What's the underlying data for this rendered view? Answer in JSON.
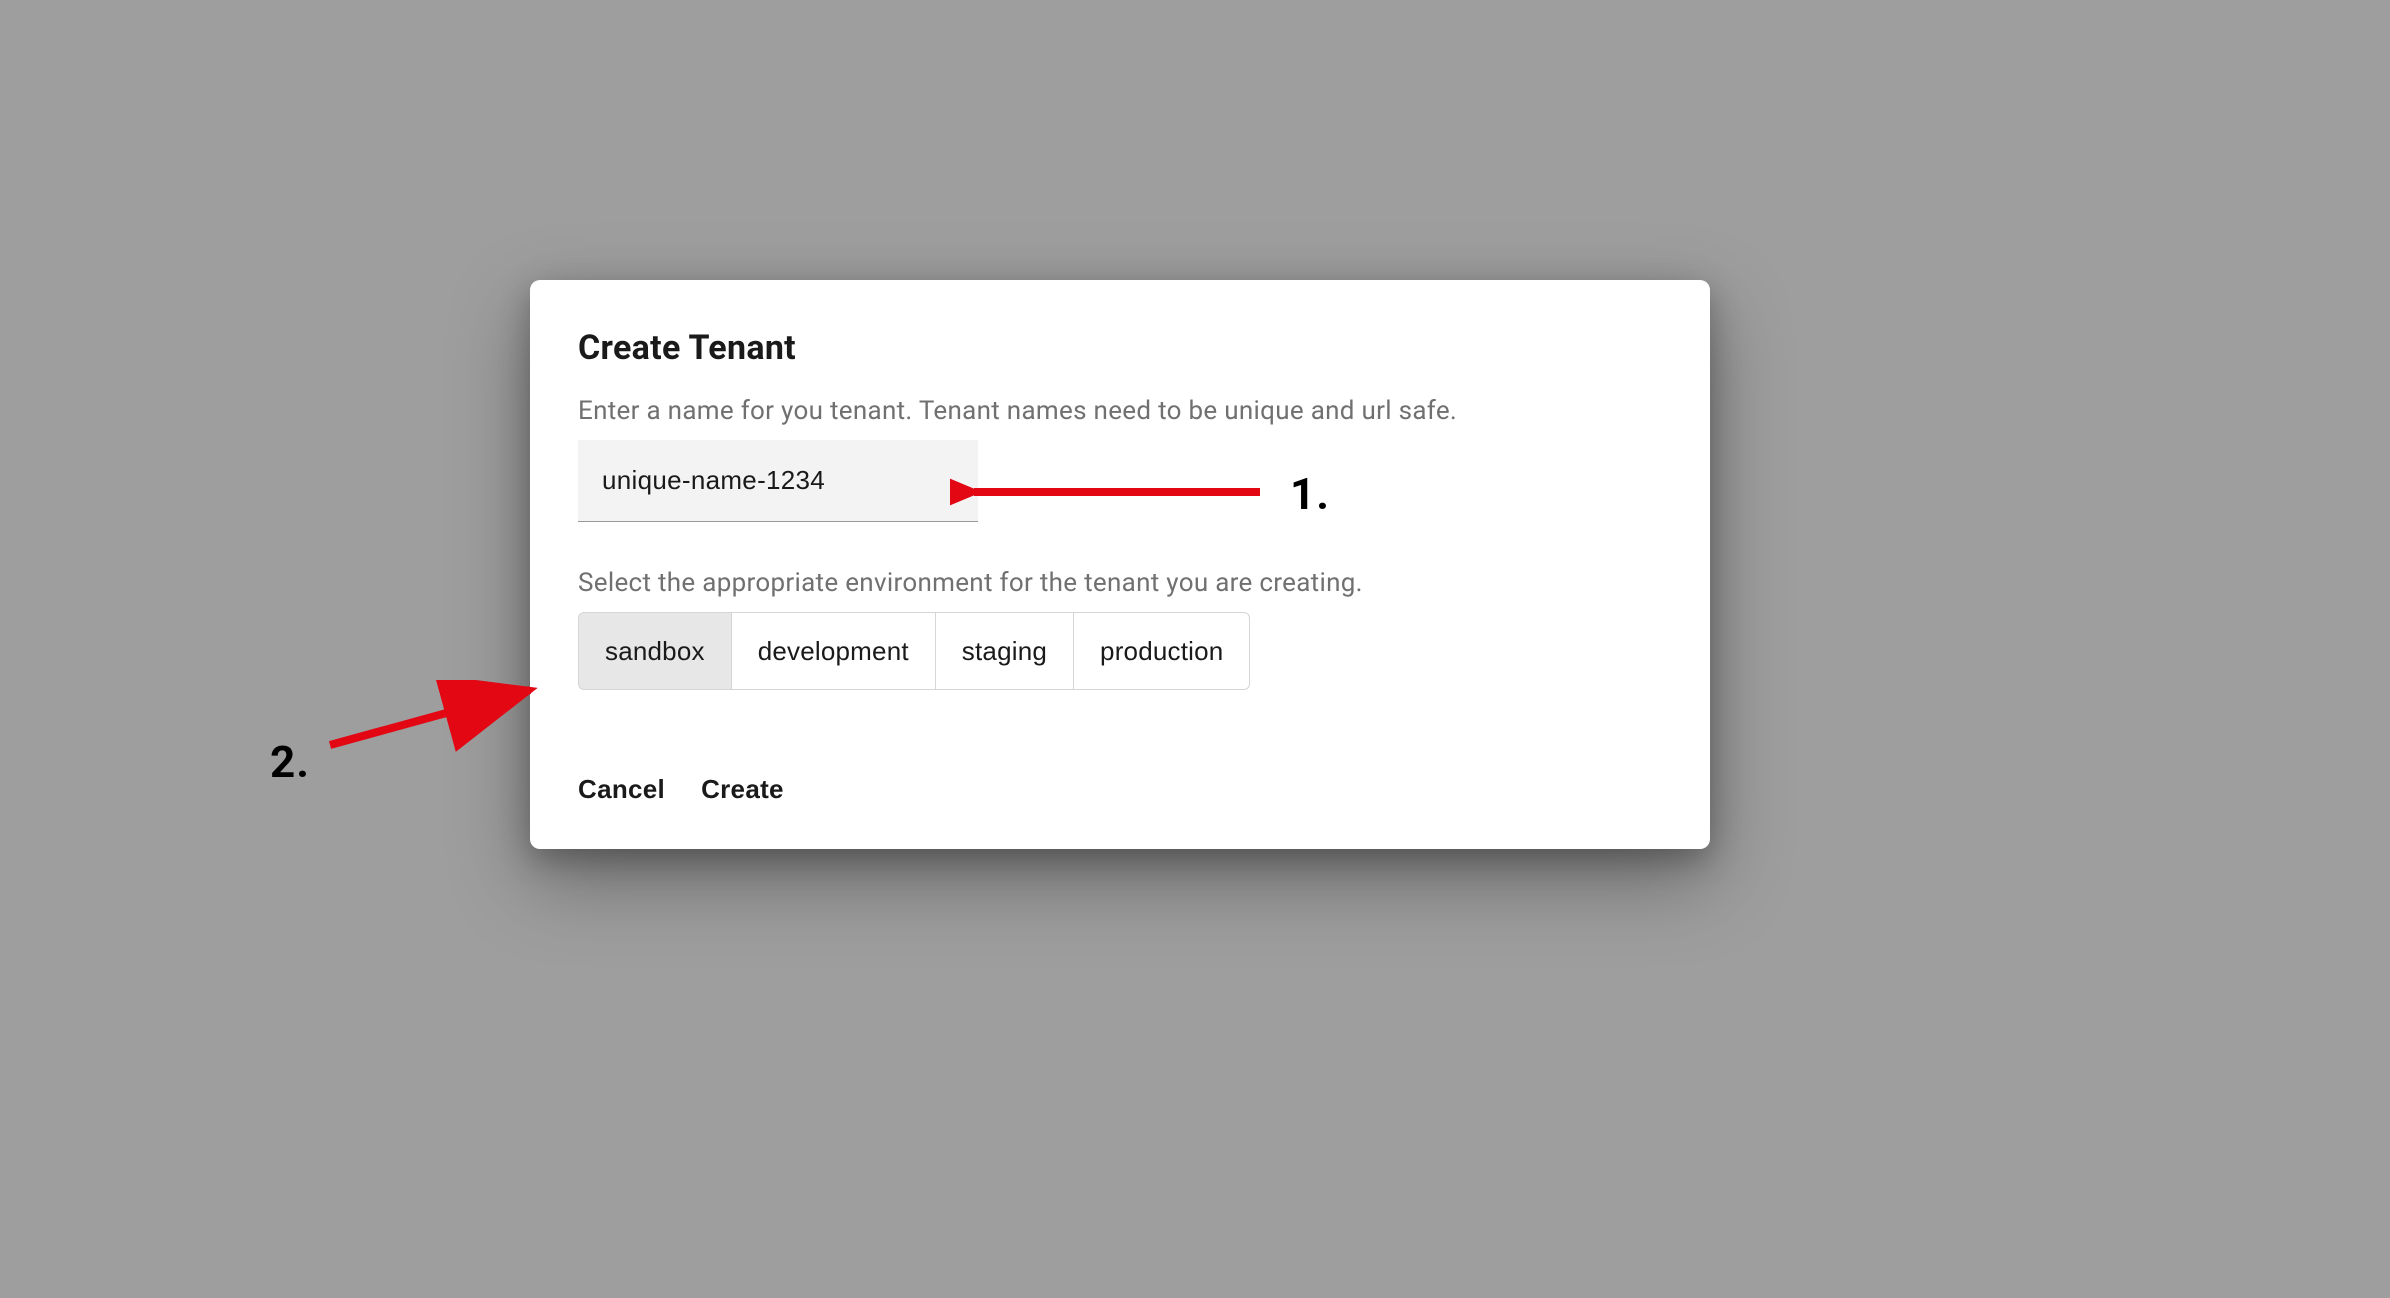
{
  "dialog": {
    "title": "Create Tenant",
    "name_helper": "Enter a name for you tenant. Tenant names need to be unique and url safe.",
    "name_value": "unique-name-1234",
    "env_helper": "Select the appropriate environment for the tenant you are creating.",
    "env_options": [
      "sandbox",
      "development",
      "staging",
      "production"
    ],
    "env_selected": "sandbox",
    "actions": {
      "cancel": "Cancel",
      "create": "Create"
    }
  },
  "annotations": {
    "label1": "1.",
    "label2": "2."
  }
}
